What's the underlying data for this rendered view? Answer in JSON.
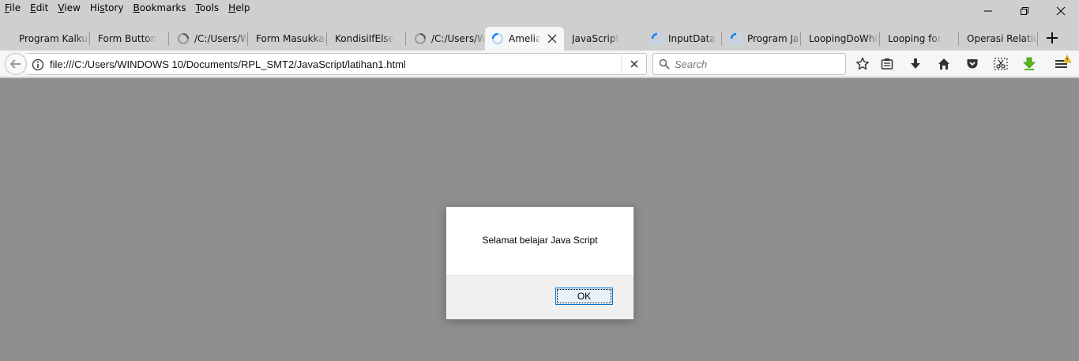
{
  "menu": [
    {
      "accel": "F",
      "rest": "ile"
    },
    {
      "accel": "E",
      "rest": "dit"
    },
    {
      "accel": "V",
      "rest": "iew"
    },
    {
      "pre": "Hi",
      "accel": "s",
      "rest": "tory"
    },
    {
      "accel": "B",
      "rest": "ookmarks"
    },
    {
      "accel": "T",
      "rest": "ools"
    },
    {
      "accel": "H",
      "rest": "elp"
    }
  ],
  "tabs": [
    {
      "label": "Program Kalkulator"
    },
    {
      "label": "Form Button"
    },
    {
      "label": "/C:/Users/WINDOWS"
    },
    {
      "label": "Form Masukkan"
    },
    {
      "label": "KondisiIfElse"
    },
    {
      "label": "/C:/Users/WINDOWS"
    },
    {
      "label": "Amelia"
    },
    {
      "label": "JavaScript"
    },
    {
      "label": "InputData"
    },
    {
      "label": "Program Java"
    },
    {
      "label": "LoopingDoWhile"
    },
    {
      "label": "Looping for"
    },
    {
      "label": "Operasi Relational"
    }
  ],
  "nav": {
    "url": "file:///C:/Users/WINDOWS 10/Documents/RPL_SMT2/JavaScript/latihan1.html",
    "search_placeholder": "Search"
  },
  "dialog": {
    "message": "Selamat belajar Java Script",
    "ok_label": "OK"
  },
  "icons": {
    "back": "back-arrow-icon",
    "info": "info-icon",
    "clear": "clear-x-icon",
    "search": "search-icon",
    "bookmark": "star-icon",
    "reader": "reading-list-icon",
    "downloads": "download-arrow-icon",
    "home": "home-icon",
    "pocket": "pocket-icon",
    "screenshot": "scissors-icon",
    "addon": "green-arrow-download-icon",
    "menu": "hamburger-menu-icon",
    "warning": "warning-badge-icon"
  },
  "colors": {
    "content_overlay": "#8e8f90",
    "chrome": "#cfcfcf",
    "toolbar": "#f5f6f7",
    "spinner": "#0a84ff",
    "ok_focus": "#0078d7"
  }
}
